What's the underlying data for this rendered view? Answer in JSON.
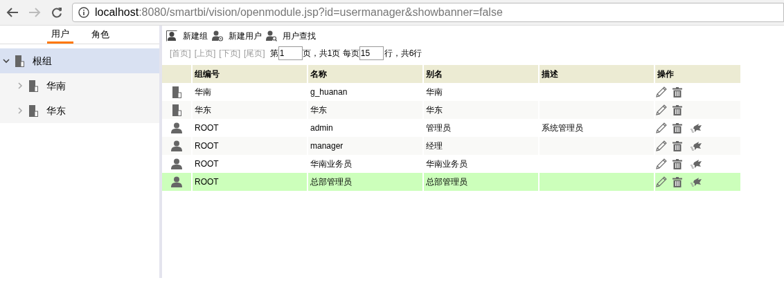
{
  "browser": {
    "back": {
      "disabled": false
    },
    "forward": {
      "disabled": true
    },
    "url_host": "localhost",
    "url_rest": ":8080/smartbi/vision/openmodule.jsp?id=usermanager&showbanner=false"
  },
  "sidebar": {
    "tabs": [
      {
        "label": "用户",
        "selected": true
      },
      {
        "label": "角色",
        "selected": false
      }
    ],
    "tree": [
      {
        "label": "根组",
        "expanded": true,
        "selected": true,
        "children": [
          {
            "label": "华南",
            "expanded": false,
            "selected": false
          },
          {
            "label": "华东",
            "expanded": false,
            "selected": false
          }
        ]
      }
    ]
  },
  "toolbar": [
    {
      "kind": "group",
      "label": "新建组"
    },
    {
      "kind": "user",
      "label": "新建用户"
    },
    {
      "kind": "search",
      "label": "用户查找"
    }
  ],
  "pager": {
    "links": [
      {
        "label": "[首页]",
        "disabled": true
      },
      {
        "label": "[上页]",
        "disabled": true
      },
      {
        "label": "[下页]",
        "disabled": true
      },
      {
        "label": "[尾页]",
        "disabled": true
      }
    ],
    "before": "第",
    "page": "1",
    "middle": "页，共1页 每页",
    "per_page": "15",
    "after": "行，共6行"
  },
  "table": {
    "columns": [
      "组编号",
      "名称",
      "别名",
      "描述",
      "操作"
    ],
    "rows": [
      {
        "kind": "group",
        "selected": false,
        "cells": [
          "华南",
          "g_huanan",
          "华南",
          ""
        ]
      },
      {
        "kind": "group",
        "selected": false,
        "cells": [
          "华东",
          "华东",
          "华东",
          ""
        ]
      },
      {
        "kind": "user",
        "selected": false,
        "cells": [
          "ROOT",
          "admin",
          "管理员",
          "系统管理员"
        ]
      },
      {
        "kind": "user",
        "selected": false,
        "cells": [
          "ROOT",
          "manager",
          "经理",
          ""
        ]
      },
      {
        "kind": "user",
        "selected": false,
        "cells": [
          "ROOT",
          "华南业务员",
          "华南业务员",
          ""
        ]
      },
      {
        "kind": "user",
        "selected": true,
        "cells": [
          "ROOT",
          "总部管理员",
          "总部管理员",
          ""
        ]
      }
    ]
  }
}
